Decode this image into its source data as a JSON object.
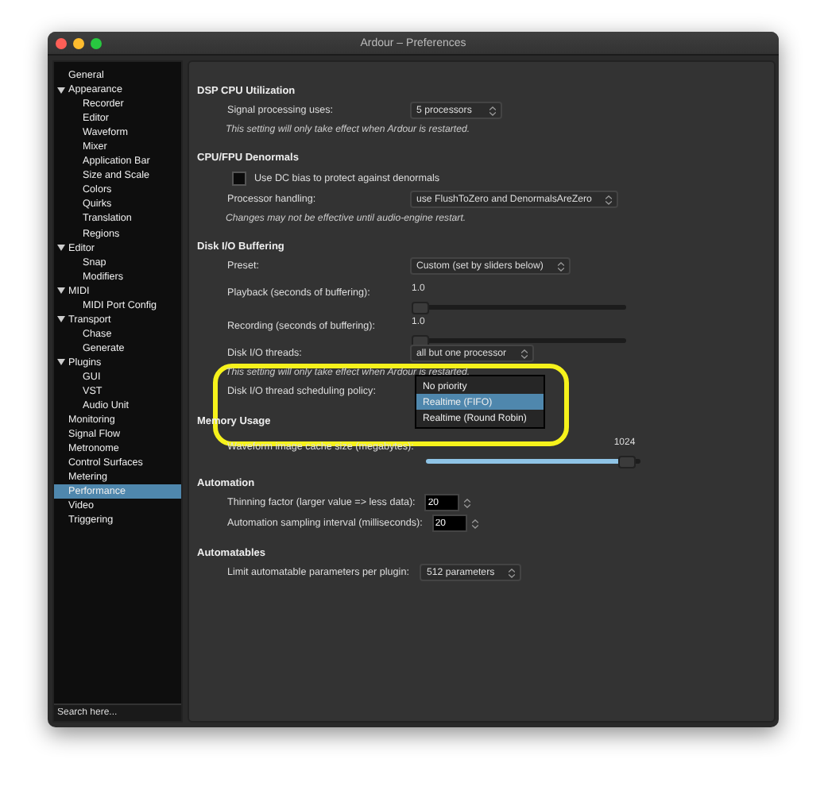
{
  "window": {
    "title": "Ardour – Preferences"
  },
  "sidebar": {
    "items": [
      {
        "label": "General",
        "selected": false
      },
      {
        "label": "Appearance",
        "selected": false,
        "expanded": true,
        "children": [
          {
            "label": "Recorder",
            "selected": false
          },
          {
            "label": "Editor",
            "selected": false
          },
          {
            "label": "Waveform",
            "selected": false
          },
          {
            "label": "Mixer",
            "selected": false
          },
          {
            "label": "Application Bar",
            "selected": false
          },
          {
            "label": "Size and Scale",
            "selected": false
          },
          {
            "label": "Colors",
            "selected": false
          },
          {
            "label": "Quirks",
            "selected": false
          },
          {
            "label": "Translation",
            "selected": false
          },
          {
            "label": "Regions",
            "selected": false
          }
        ]
      },
      {
        "label": "Editor",
        "selected": false,
        "expanded": true,
        "children": [
          {
            "label": "Snap",
            "selected": false
          },
          {
            "label": "Modifiers",
            "selected": false
          }
        ]
      },
      {
        "label": "MIDI",
        "selected": false,
        "expanded": true,
        "children": [
          {
            "label": "MIDI Port Config",
            "selected": false
          }
        ]
      },
      {
        "label": "Transport",
        "selected": false,
        "expanded": true,
        "children": [
          {
            "label": "Chase",
            "selected": false
          },
          {
            "label": "Generate",
            "selected": false
          }
        ]
      },
      {
        "label": "Plugins",
        "selected": false,
        "expanded": true,
        "children": [
          {
            "label": "GUI",
            "selected": false
          },
          {
            "label": "VST",
            "selected": false
          },
          {
            "label": "Audio Unit",
            "selected": false
          }
        ]
      },
      {
        "label": "Monitoring",
        "selected": false
      },
      {
        "label": "Signal Flow",
        "selected": false
      },
      {
        "label": "Metronome",
        "selected": false
      },
      {
        "label": "Control Surfaces",
        "selected": false
      },
      {
        "label": "Metering",
        "selected": false
      },
      {
        "label": "Performance",
        "selected": true
      },
      {
        "label": "Video",
        "selected": false
      },
      {
        "label": "Triggering",
        "selected": false
      }
    ],
    "search": {
      "placeholder": "Search here..."
    }
  },
  "sections": [
    {
      "heading": "DSP CPU Utilization",
      "rows": [
        {
          "kind": "select",
          "label": "Signal processing uses:",
          "value": "5 processors"
        },
        {
          "kind": "note",
          "text": "This setting will only take effect when Ardour is restarted."
        }
      ]
    },
    {
      "heading": "CPU/FPU Denormals",
      "rows": [
        {
          "kind": "checkbox",
          "label": "Use DC bias to protect against denormals",
          "checked": false
        },
        {
          "kind": "select",
          "label": "Processor handling:",
          "value": "use FlushToZero and DenormalsAreZero"
        },
        {
          "kind": "note",
          "text": "Changes may not be effective until audio-engine restart."
        }
      ]
    },
    {
      "heading": "Disk I/O Buffering",
      "rows": [
        {
          "kind": "select",
          "label": "Preset:",
          "value": "Custom (set by sliders below)"
        },
        {
          "kind": "slider",
          "label": "Playback (seconds of buffering):",
          "reading": "1.0",
          "level": 0.0
        },
        {
          "kind": "slider",
          "label": "Recording (seconds of buffering):",
          "reading": "1.0",
          "level": 0.0
        },
        {
          "kind": "select",
          "label": "Disk I/O threads:",
          "value": "all but one processor"
        },
        {
          "kind": "note",
          "text": "This setting will only take effect when Ardour is restarted."
        },
        {
          "kind": "popup",
          "label": "Disk I/O thread scheduling policy:",
          "highlight": true,
          "options": [
            {
              "label": "No priority",
              "selected": false
            },
            {
              "label": "Realtime (FIFO)",
              "selected": true
            },
            {
              "label": "Realtime (Round Robin)",
              "selected": false
            }
          ]
        }
      ]
    },
    {
      "heading": "Memory Usage",
      "rows": [
        {
          "kind": "slider",
          "label": "Waveform image cache size (megabytes):",
          "reading": "1024",
          "level": 0.97
        }
      ]
    },
    {
      "heading": "Automation",
      "rows": [
        {
          "kind": "spin",
          "label": "Thinning factor (larger value => less data):",
          "value": "20"
        },
        {
          "kind": "spin",
          "label": "Automation sampling interval (milliseconds):",
          "value": "20"
        }
      ]
    },
    {
      "heading": "Automatables",
      "rows": [
        {
          "kind": "select",
          "label": "Limit automatable parameters per plugin:",
          "value": "512 parameters"
        }
      ]
    }
  ]
}
